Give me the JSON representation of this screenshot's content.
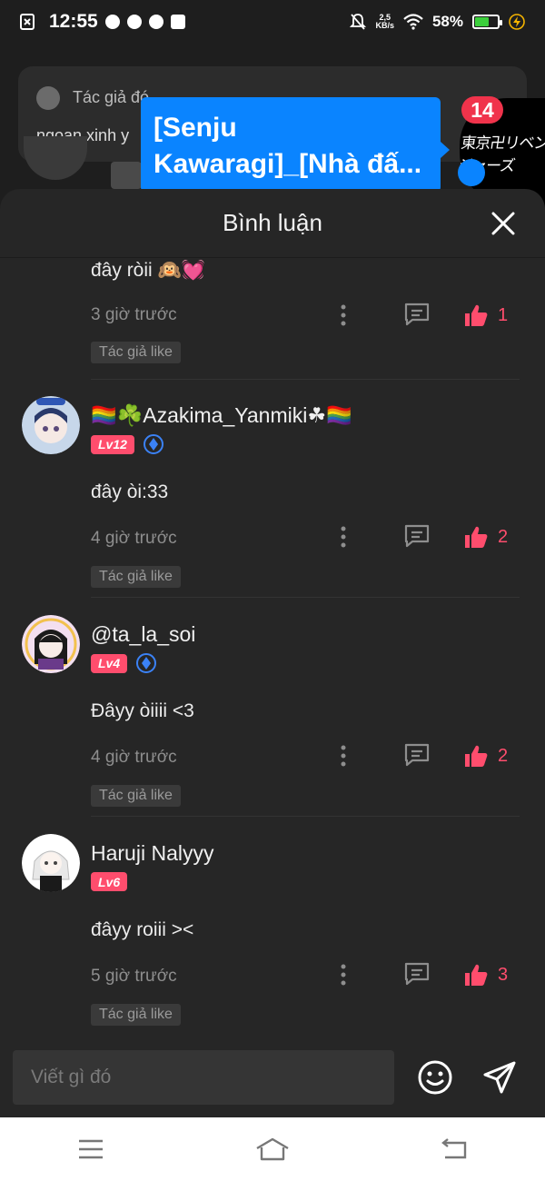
{
  "status_bar": {
    "time": "12:55",
    "net_speed_value": "2,5",
    "net_speed_unit": "KB/s",
    "battery": "58%",
    "battery_level": 0.58,
    "notification_icons": [
      "screenshot-icon",
      "messenger-icon",
      "zalo-icon",
      "chrome-icon",
      "baomoi-icon"
    ]
  },
  "background_card": {
    "author": "Tác giả đó",
    "text": "ngoan xinh y"
  },
  "story_popup": {
    "title": "[Senju Kawaragi]_[Nhà đấ...",
    "badge_count": "14"
  },
  "sheet": {
    "title": "Bình luận"
  },
  "comments": [
    {
      "text": "đây ròii 🙉💓",
      "time": "3 giờ trước",
      "likes": "1",
      "author_like": "Tác giả like"
    },
    {
      "name": "🏳️‍🌈☘️Azakima_Yanmiki☘🏳️‍🌈",
      "level": "Lv12",
      "verified": true,
      "text": "đây òi:33",
      "time": "4 giờ trước",
      "likes": "2",
      "author_like": "Tác giả like"
    },
    {
      "name": "@ta_la_soi",
      "level": "Lv4",
      "verified": true,
      "text": "Đâyy òiiii <3",
      "time": "4 giờ trước",
      "likes": "2",
      "author_like": "Tác giả like"
    },
    {
      "name": "Haruji Nalyyy",
      "level": "Lv6",
      "verified": false,
      "text": "đâyy roiii ><",
      "time": "5 giờ trước",
      "likes": "3",
      "author_like": "Tác giả like"
    }
  ],
  "input": {
    "placeholder": "Viết gì đó"
  },
  "colors": {
    "accent_blue": "#0a84ff",
    "like_pink": "#ff4d6d",
    "sheet_bg": "#262626"
  }
}
